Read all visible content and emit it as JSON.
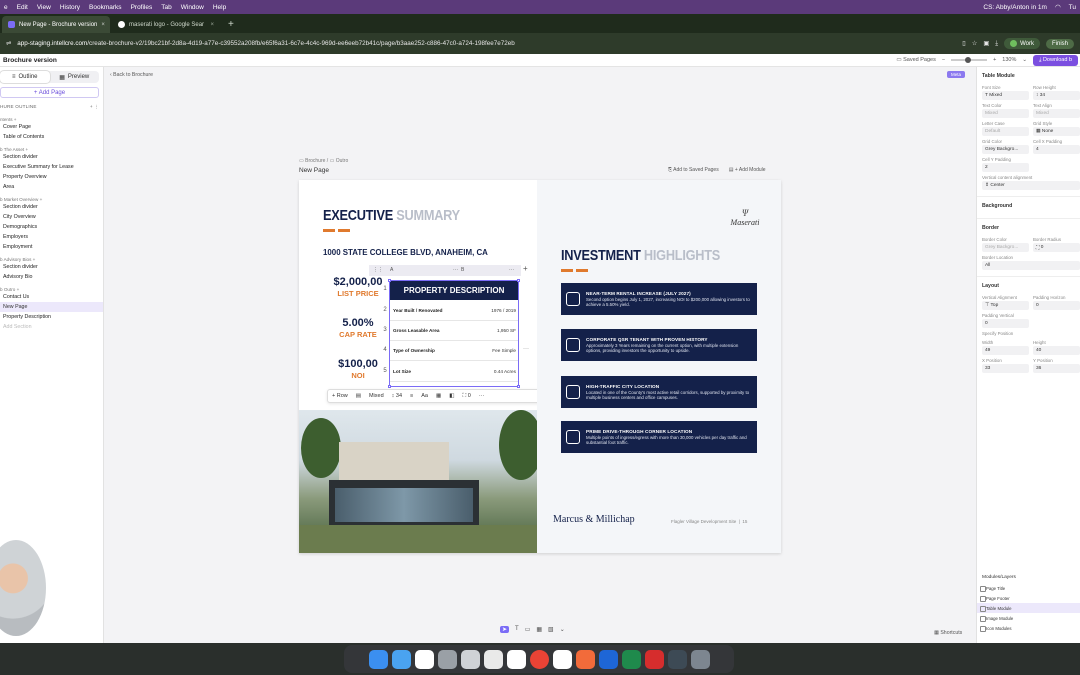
{
  "menubar": {
    "items": [
      "e",
      "Edit",
      "View",
      "History",
      "Bookmarks",
      "Profiles",
      "Tab",
      "Window",
      "Help"
    ],
    "status": "CS: Abby/Anton in 1m",
    "time": "Tu"
  },
  "tabs": [
    {
      "label": "New Page - Brochure version"
    },
    {
      "label": "maserati logo - Google Sear"
    }
  ],
  "address": {
    "url_host": "app-staging.intellcre.com",
    "url_path": "/create-brochure-v2/19bc21bf-2d8a-4d19-a77e-c39552a208fb/e65f6a31-6c7e-4c4c-969d-ee6eeb72b41c/page/b3aae252-c886-47c0-a724-198fee7e72eb",
    "work_label": "Work",
    "finish_label": "Finish"
  },
  "header": {
    "title": "Brochure version",
    "saved_pages": "Saved Pages",
    "zoom": "130%",
    "download": "Download b"
  },
  "sidebar": {
    "outline_tab": "Outline",
    "preview_tab": "Preview",
    "add_page": "+ Add Page",
    "outline_label": "HURE OUTLINE",
    "groups": [
      {
        "label": "ntents +",
        "items": [
          "Cover Page",
          "Table of Contents"
        ]
      },
      {
        "label": "b The Asset +",
        "items": [
          "Section divider",
          "Executive Summary for Lease",
          "Property Overview",
          "Area"
        ]
      },
      {
        "label": "b Market Overview +",
        "items": [
          "Section divider",
          "City Overview",
          "Demographics",
          "Employers",
          "Employment"
        ]
      },
      {
        "label": "b Advisory Bios +",
        "items": [
          "Section divider",
          "Advisory Bio"
        ]
      },
      {
        "label": "b Outro +",
        "items": [
          "Contact Us",
          "New Page",
          "Property Description"
        ]
      }
    ],
    "muted_item": "Add Section"
  },
  "canvas": {
    "back": "Back to Brochure",
    "breadcrumb_a": "Brochure",
    "breadcrumb_b": "Outro",
    "page_title": "New Page",
    "add_saved": "Add to Saved Pages",
    "add_module": "+ Add Module",
    "meta_badge": "Meta"
  },
  "brochure": {
    "left_title_a": "EXECUTIVE",
    "left_title_b": "SUMMARY",
    "address": "1000 STATE COLLEGE BLVD, ANAHEIM, CA",
    "stats": [
      {
        "value": "$2,000,00",
        "label": "LIST PRICE"
      },
      {
        "value": "5.00%",
        "label": "CAP RATE"
      },
      {
        "value": "$100,00",
        "label": "NOI"
      }
    ],
    "right_title_a": "INVESTMENT",
    "right_title_b": "HIGHLIGHTS",
    "logo_text": "Maserati",
    "highlights": [
      {
        "title": "NEAR-TERM RENTAL INCREASE (JULY 2027)",
        "desc": "Second option begins July 1, 2027, increasing NOI to $200,000 allowing investors to achieve a 5.50% yield."
      },
      {
        "title": "CORPORATE QSR TENANT WITH PROVEN HISTORY",
        "desc": "Approximately 3 Years remaining on the current option, with multiple extension options, providing investors the opportunity to upside."
      },
      {
        "title": "HIGH-TRAFFIC CITY LOCATION",
        "desc": "Located in one of the County's most active retail corridors, supported by proximity to multiple business centers and office campuses."
      },
      {
        "title": "PRIME DRIVE-THROUGH CORNER LOCATION",
        "desc": "Multiple points of ingress/egress with more than 30,000 vehicles per day traffic and substantial foot traffic."
      }
    ],
    "brand": "Marcus & Millichap",
    "footer": "Flagler Village Development Site",
    "page_no": "15"
  },
  "table": {
    "col_a": "A",
    "col_b": "B",
    "header": "PROPERTY DESCRIPTION",
    "rows": [
      {
        "n": "1",
        "k": "",
        "v": ""
      },
      {
        "n": "2",
        "k": "Year Built / Renovated",
        "v": "1976 / 2019"
      },
      {
        "n": "3",
        "k": "Gross Leasable Area",
        "v": "1,950 SF"
      },
      {
        "n": "4",
        "k": "Type of Ownership",
        "v": "Fee Simple"
      },
      {
        "n": "5",
        "k": "Lot Size",
        "v": "0.44 Acres"
      }
    ]
  },
  "fmtbar": {
    "row": "+ Row",
    "font": "Mixed",
    "size": "34",
    "aa": "Aa",
    "pad": "0"
  },
  "panel": {
    "title": "Table Module",
    "font_size_lbl": "Font Size",
    "font_size": "Mixed",
    "row_height_lbl": "Row Height",
    "row_height": "34",
    "text_color_lbl": "Text Color",
    "text_color": "Mixed",
    "text_align_lbl": "Text Align",
    "text_align": "Mixed",
    "letter_case_lbl": "Letter Case",
    "letter_case": "Default",
    "grid_style_lbl": "Grid Style",
    "grid_style": "None",
    "grid_color_lbl": "Grid Color",
    "grid_color": "Grey Backgro...",
    "cellx_lbl": "Cell X Padding",
    "cellx": "4",
    "celly_lbl": "Cell Y Padding",
    "celly": "2",
    "valign_lbl": "Vertical content alignment",
    "valign": "Center",
    "background": "Background",
    "border": "Border",
    "border_color_lbl": "Border Color",
    "border_color": "Grey Backgro...",
    "border_radius_lbl": "Border Radius",
    "border_radius": "0",
    "border_loc_lbl": "Border Location",
    "border_loc": "All",
    "layout": "Layout",
    "valign2_lbl": "Vertical Alignment",
    "valign2": "Top",
    "padh_lbl": "Padding Horizon",
    "padh": "0",
    "padv_lbl": "Padding Vertical",
    "padv": "0",
    "specify": "Specify Position",
    "width_lbl": "Width",
    "width": "49",
    "height_lbl": "Height",
    "height": "40",
    "xpos_lbl": "X Position",
    "xpos": "33",
    "ypos_lbl": "Y Position",
    "ypos": "36",
    "layers_title": "Modules/Layers",
    "layers": [
      "Page Title",
      "Page Footer",
      "Table Module",
      "Image Module",
      "Icon Modules"
    ]
  },
  "shortcuts": "Shortcuts",
  "colors": {
    "navy": "#14214a",
    "orange": "#e07a2e",
    "accent": "#7b4fe0"
  }
}
